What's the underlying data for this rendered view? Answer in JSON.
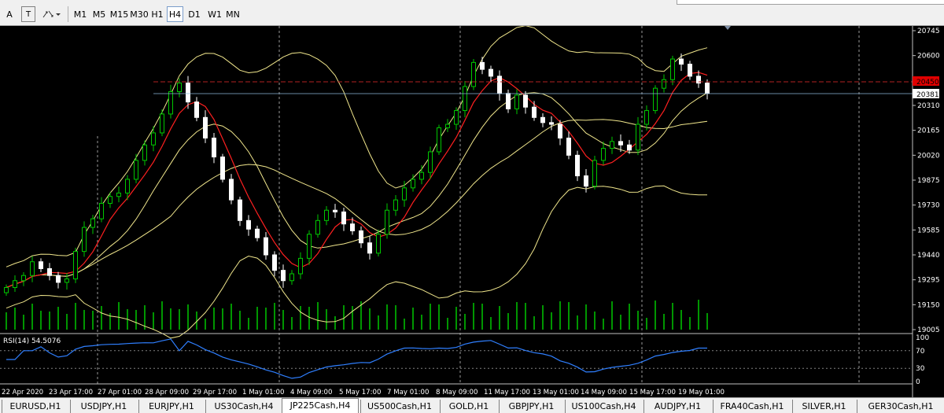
{
  "toolbar": {
    "text_tool": "A",
    "label_tool": "T",
    "timeframes": [
      "M1",
      "M5",
      "M15",
      "M30",
      "H1",
      "H4",
      "D1",
      "W1",
      "MN"
    ],
    "active_timeframe": "H4"
  },
  "chart": {
    "price_levels": [
      "20745",
      "20600",
      "20455",
      "20310",
      "20165",
      "20020",
      "19875",
      "19730",
      "19585",
      "19440",
      "19295",
      "19150",
      "19005"
    ],
    "current_price": "20381",
    "line_price": "20450",
    "rsi": {
      "label": "RSI(14) 54.5076",
      "levels": [
        "100",
        "70",
        "30",
        "0"
      ]
    },
    "dates": [
      "22 Apr 2020",
      "23 Apr 17:00",
      "27 Apr 01:00",
      "28 Apr 09:00",
      "29 Apr 17:00",
      "1 May 01:00",
      "4 May 09:00",
      "5 May 17:00",
      "7 May 01:00",
      "8 May 09:00",
      "11 May 17:00",
      "13 May 01:00",
      "14 May 09:00",
      "15 May 17:00",
      "19 May 01:00"
    ]
  },
  "chart_data": {
    "type": "candlestick",
    "symbol": "JP225Cash",
    "timeframe": "H4",
    "closes": [
      19250,
      19290,
      19320,
      19400,
      19360,
      19320,
      19280,
      19300,
      19460,
      19600,
      19650,
      19740,
      19780,
      19800,
      19880,
      19990,
      20080,
      20150,
      20260,
      20390,
      20440,
      20330,
      20240,
      20120,
      20010,
      19880,
      19760,
      19640,
      19590,
      19540,
      19440,
      19350,
      19290,
      19330,
      19420,
      19560,
      19640,
      19700,
      19690,
      19620,
      19580,
      19510,
      19450,
      19560,
      19700,
      19760,
      19830,
      19880,
      19920,
      20040,
      20180,
      20200,
      20280,
      20420,
      20560,
      20520,
      20480,
      20380,
      20290,
      20370,
      20300,
      20240,
      20210,
      20200,
      20120,
      20020,
      19900,
      19840,
      19990,
      20060,
      20100,
      20080,
      20050,
      20200,
      20280,
      20410,
      20460,
      20580,
      20550,
      20480,
      20440,
      20380
    ],
    "current_price": 20381,
    "horizontal_line": 20450,
    "rsi_period": 14,
    "rsi_value": 54.5076,
    "ylim": [
      19005,
      20745
    ]
  },
  "tabs": [
    {
      "label": "EURUSD,H1",
      "active": false
    },
    {
      "label": "USDJPY,H1",
      "active": false
    },
    {
      "label": "EURJPY,H1",
      "active": false
    },
    {
      "label": "US30Cash,H4",
      "active": false
    },
    {
      "label": "JP225Cash,H4",
      "active": true
    },
    {
      "label": "US500Cash,H1",
      "active": false
    },
    {
      "label": "GOLD,H1",
      "active": false
    },
    {
      "label": "GBPJPY,H1",
      "active": false
    },
    {
      "label": "US100Cash,H4",
      "active": false
    },
    {
      "label": "AUDJPY,H1",
      "active": false
    },
    {
      "label": "FRA40Cash,H1",
      "active": false
    },
    {
      "label": "SILVER,H1",
      "active": false
    },
    {
      "label": "GER30Cash,H1",
      "active": false
    }
  ],
  "colors": {
    "background": "#000000",
    "bull_candle": "#00c800",
    "bear_candle": "#ffffff",
    "bands": "#f0e68c",
    "ma": "#ff2020",
    "rsi_line": "#2f7fff",
    "price_line": "#b22222"
  }
}
